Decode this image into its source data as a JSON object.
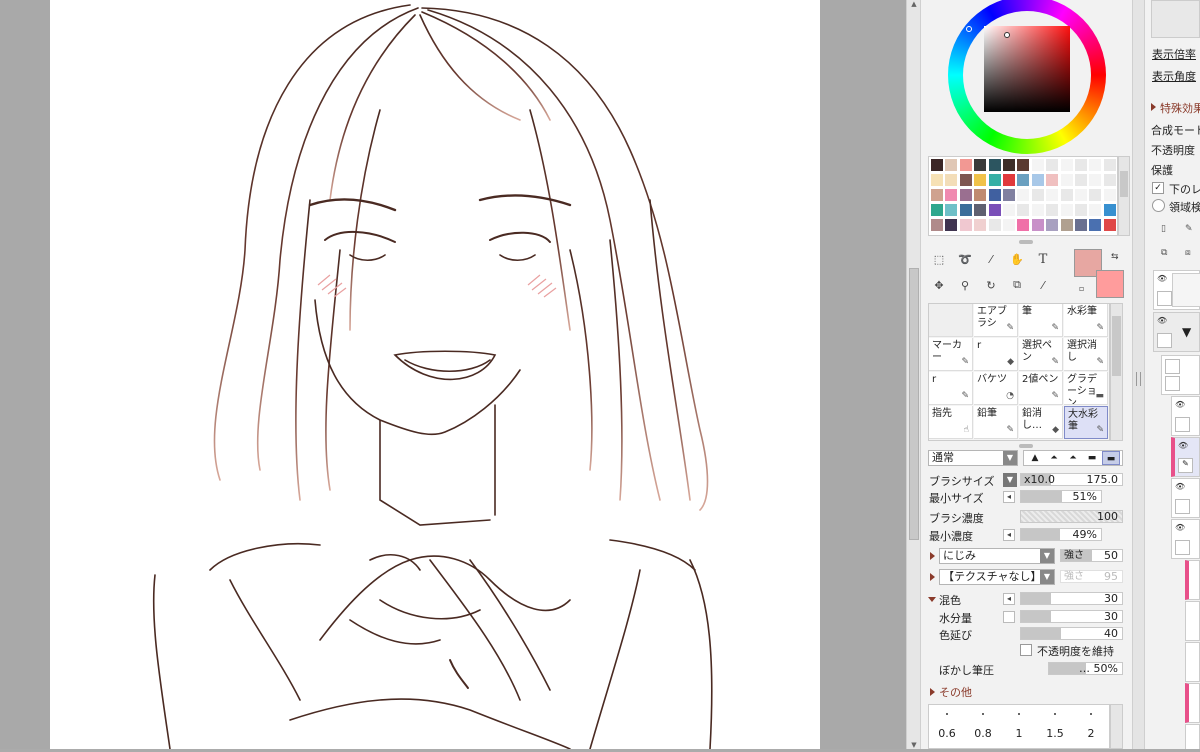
{
  "colors": {
    "primary": "#e7a7a2",
    "secondary": "#ff9c9c",
    "sketch_line": "#4a2a22",
    "accent_label": "#8a3a2a",
    "selected_brush_bg": "#dde0f6"
  },
  "palette": {
    "rows": [
      [
        "#3b2626",
        "#e0c7b5",
        "#f29893",
        "#3a3a3a",
        "#2c5560",
        "#3d2e28",
        "#5a3a30",
        "#f4f4f4",
        "#e8e8e8",
        "#f4f4f4",
        "#e8e8e8",
        "#f4f4f4",
        "#e8e8e8"
      ],
      [
        "#f6e1b5",
        "#f3ddb8",
        "#7e5751",
        "#f0c24a",
        "#36b0a5",
        "#e03a3c",
        "#6aa0c0",
        "#a8c8e8",
        "#f0c0c0",
        "#f4f4f4",
        "#e8e8e8",
        "#f4f4f4",
        "#e8e8e8"
      ],
      [
        "#cfa28f",
        "#f08ab0",
        "#9a6f90",
        "#c08a70",
        "#4060a0",
        "#8080a0",
        "#f4f4f4",
        "#e8e8e8",
        "#f4f4f4",
        "#e8e8e8",
        "#f4f4f4",
        "#e8e8e8",
        "#f4f4f4"
      ],
      [
        "#2fa78d",
        "#6fc0c8",
        "#3b6e9a",
        "#5f6070",
        "#7a4fb8",
        "#f4f4f4",
        "#e8e8e8",
        "#f4f4f4",
        "#e8e8e8",
        "#f4f4f4",
        "#e8e8e8",
        "#f4f4f4",
        "#3890d0"
      ],
      [
        "#b08a8a",
        "#3f3450",
        "#f0c8d0",
        "#f0d0d0",
        "#e8e8e8",
        "#f4f4f4",
        "#f070a8",
        "#c890c8",
        "#a8a0c0",
        "#b0a090",
        "#6a7090",
        "#4a70b0",
        "#e04848"
      ]
    ]
  },
  "tools": {
    "row1": [
      "select-rect-icon",
      "lasso-icon",
      "magic-wand-icon",
      "hand-icon",
      "text-tool-icon"
    ],
    "row2": [
      "move-icon",
      "zoom-icon",
      "rotate-icon",
      "copy-icon",
      "eyedropper-icon"
    ],
    "text_tool_glyph": "T"
  },
  "brushes": [
    {
      "label": "",
      "empty": true
    },
    {
      "label": "エアブラシ",
      "icon": "✎"
    },
    {
      "label": "筆",
      "icon": "✎"
    },
    {
      "label": "水彩筆",
      "icon": "✎"
    },
    {
      "label": "マーカー",
      "icon": "✎"
    },
    {
      "label": "r",
      "icon": "◆"
    },
    {
      "label": "選択ペン",
      "icon": "✎"
    },
    {
      "label": "選択消し",
      "icon": "✎"
    },
    {
      "label": "r",
      "icon": "✎"
    },
    {
      "label": "バケツ",
      "icon": "◔"
    },
    {
      "label": "2値ペン",
      "icon": "✎"
    },
    {
      "label": "グラデーション",
      "icon": "▬"
    },
    {
      "label": "指先",
      "icon": "☝"
    },
    {
      "label": "鉛筆",
      "icon": "✎"
    },
    {
      "label": "鉛消し…",
      "icon": "◆"
    },
    {
      "label": "大水彩筆",
      "icon": "✎",
      "selected": true
    }
  ],
  "brush_settings": {
    "blend_mode": "通常",
    "brush_size_label": "ブラシサイズ",
    "brush_size_multiplier": "x10.0",
    "brush_size_value": "175.0",
    "min_size_label": "最小サイズ",
    "min_size_value": "51%",
    "min_size_fraction": 0.51,
    "density_label": "ブラシ濃度",
    "density_value": "100",
    "density_fraction": 1.0,
    "min_density_label": "最小濃度",
    "min_density_value": "49%",
    "min_density_fraction": 0.49,
    "blur_dropdown": "にじみ",
    "blur_strength_label": "強さ",
    "blur_strength_value": "50",
    "texture_dropdown": "【テクスチャなし】",
    "texture_strength_label": "強さ",
    "texture_strength_value": "95",
    "mix_label": "混色",
    "mix_value": "30",
    "mix_fraction": 0.3,
    "water_label": "水分量",
    "water_value": "30",
    "water_fraction": 0.3,
    "color_ext_label": "色延び",
    "color_ext_value": "40",
    "color_ext_fraction": 0.4,
    "keep_opacity_label": "不透明度を維持",
    "blur_pressure_label": "ぼかし筆圧",
    "blur_pressure_value": "… 50%",
    "blur_pressure_fraction": 0.5,
    "other_label": "その他"
  },
  "pressure_scale": [
    "0.6",
    "0.8",
    "1",
    "1.5",
    "2"
  ],
  "navigator": {
    "zoom_label": "表示倍率",
    "angle_label": "表示角度",
    "special_effects_label": "特殊効果",
    "blend_mode_label": "合成モード",
    "opacity_label": "不透明度",
    "protect_label": "保護",
    "clip_label": "下のレイヤー",
    "area_label": "領域検出"
  }
}
